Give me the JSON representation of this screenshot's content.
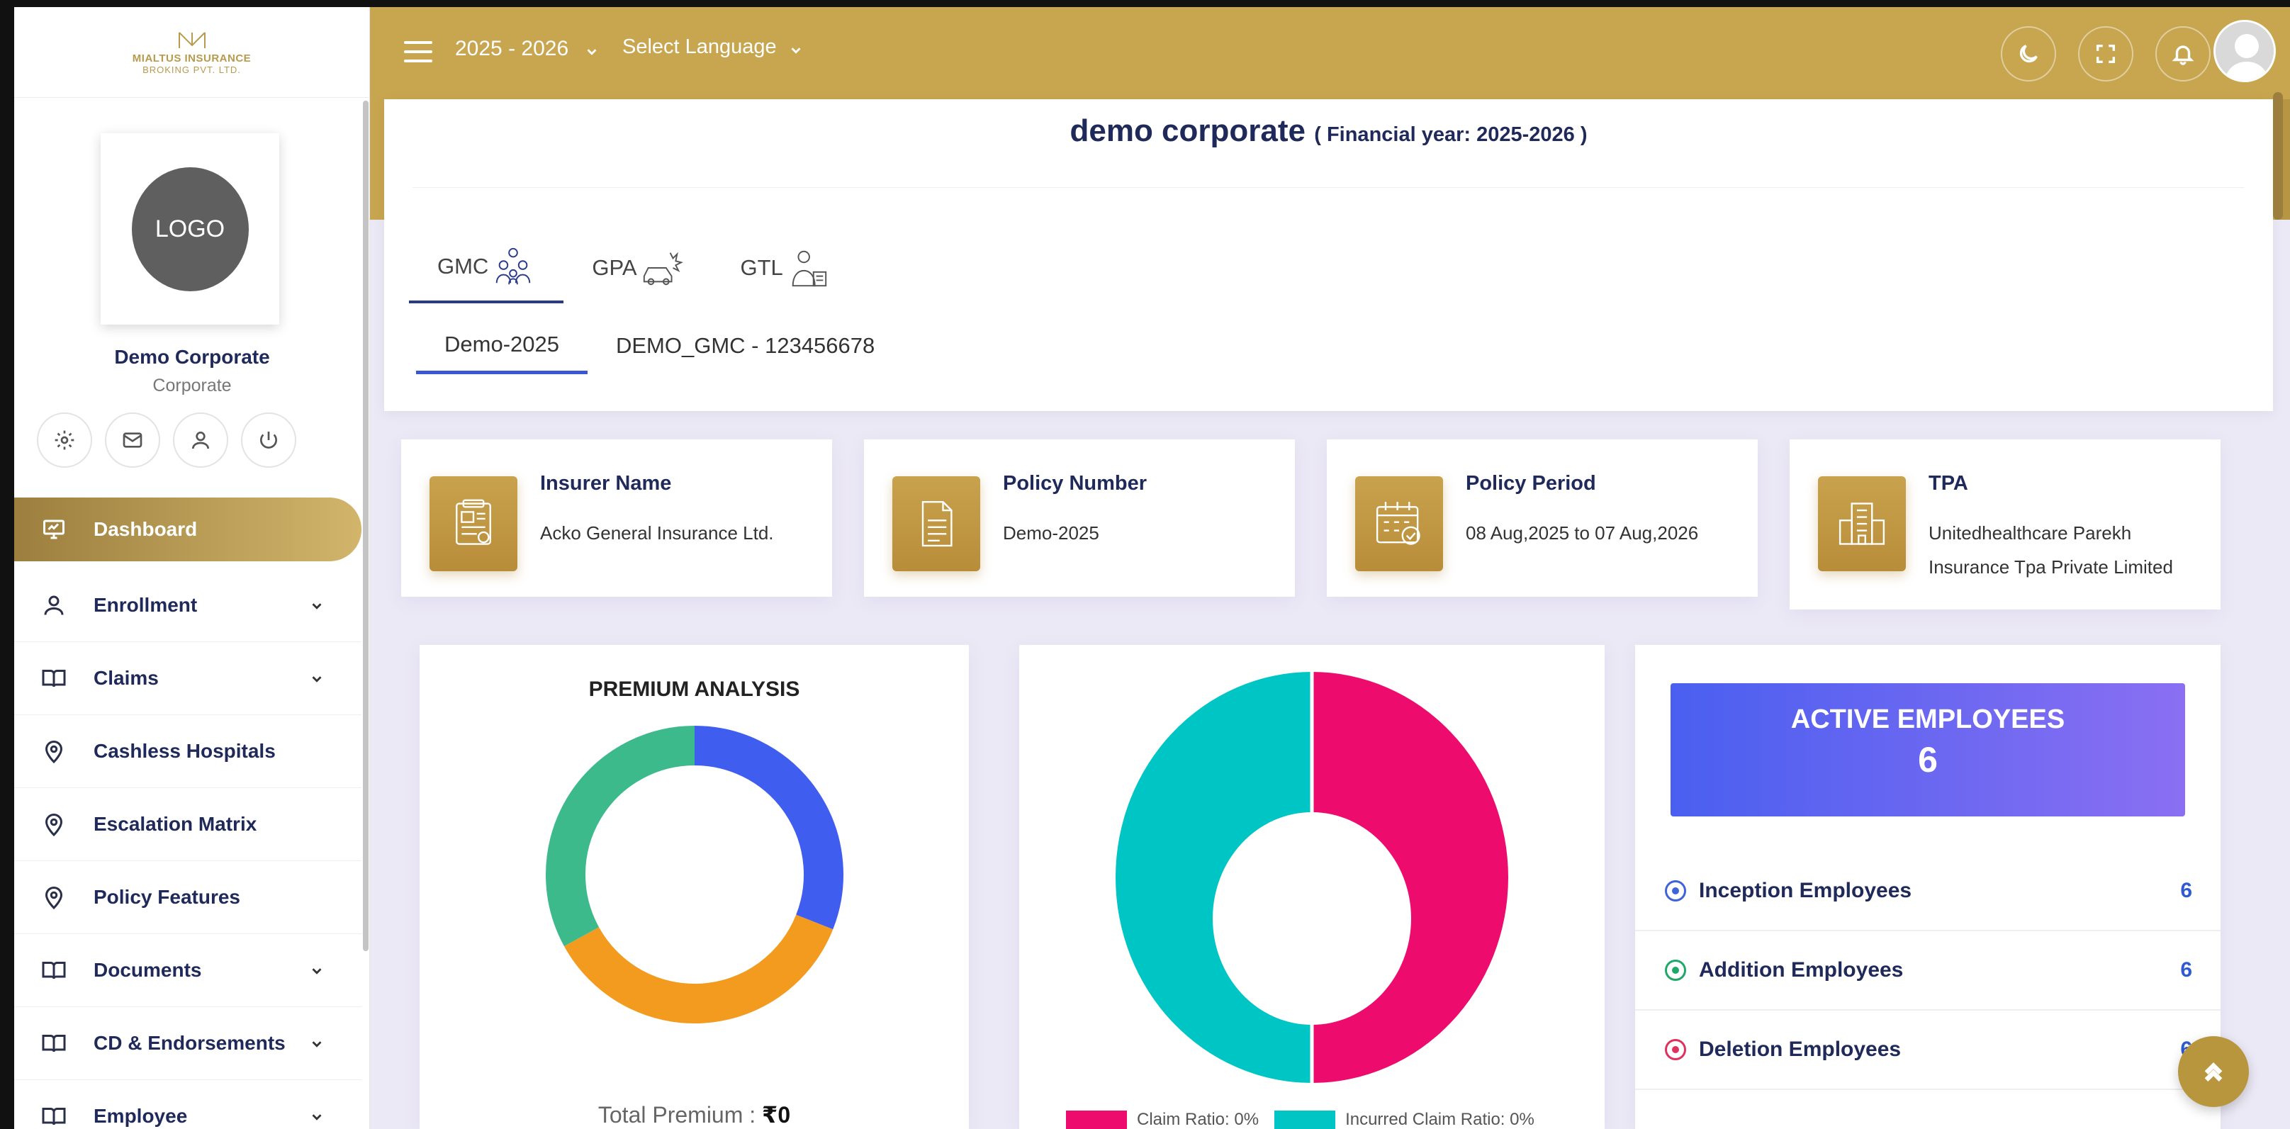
{
  "brand": {
    "name": "MIALTUS INSURANCE",
    "sub": "BROKING PVT. LTD."
  },
  "profile": {
    "logo_text": "LOGO",
    "name": "Demo Corporate",
    "type": "Corporate"
  },
  "menu": [
    {
      "label": "Dashboard",
      "icon": "monitor-icon",
      "expandable": false,
      "active": true
    },
    {
      "label": "Enrollment",
      "icon": "user-icon",
      "expandable": true
    },
    {
      "label": "Claims",
      "icon": "book-icon",
      "expandable": true
    },
    {
      "label": "Cashless Hospitals",
      "icon": "map-pin-icon",
      "expandable": false
    },
    {
      "label": "Escalation Matrix",
      "icon": "map-pin-icon",
      "expandable": false
    },
    {
      "label": "Policy Features",
      "icon": "map-pin-icon",
      "expandable": false
    },
    {
      "label": "Documents",
      "icon": "book-icon",
      "expandable": true
    },
    {
      "label": "CD & Endorsements",
      "icon": "book-icon",
      "expandable": true
    },
    {
      "label": "Employee",
      "icon": "book-icon",
      "expandable": true
    }
  ],
  "header": {
    "financial_year": "2025 - 2026",
    "language": "Select Language"
  },
  "page": {
    "company": "demo corporate",
    "fy_note": "( Financial year: 2025-2026 )"
  },
  "policy_tabs": [
    {
      "label": "GMC",
      "icon": "family-icon",
      "active": true
    },
    {
      "label": "GPA",
      "icon": "car-accident-icon",
      "active": false
    },
    {
      "label": "GTL",
      "icon": "life-insurance-icon",
      "active": false
    }
  ],
  "sub_tabs": [
    {
      "label": "Demo-2025",
      "active": true
    },
    {
      "label": "DEMO_GMC - 123456678",
      "active": false
    }
  ],
  "info_cards": [
    {
      "title": "Insurer Name",
      "value": "Acko General Insurance Ltd.",
      "icon": "id-card-icon"
    },
    {
      "title": "Policy Number",
      "value": "Demo-2025",
      "icon": "document-icon"
    },
    {
      "title": "Policy Period",
      "value": "08 Aug,2025 to 07 Aug,2026",
      "icon": "calendar-icon"
    },
    {
      "title": "TPA",
      "value": "Unitedhealthcare Parekh Insurance Tpa Private Limited",
      "icon": "building-icon"
    }
  ],
  "premium": {
    "title": "PREMIUM ANALYSIS",
    "total_label": "Total Premium :",
    "total_value": "₹0"
  },
  "premium_ring": {
    "segments": [
      {
        "color": "#3f5ef0",
        "fraction": 0.31
      },
      {
        "color": "#f29b1f",
        "fraction": 0.36
      },
      {
        "color": "#3dba8c",
        "fraction": 0.33
      }
    ]
  },
  "claim_chart": {
    "legend": [
      {
        "label": "Claim Ratio: 0%",
        "color": "#ee0b6e"
      },
      {
        "label": "Incurred Claim Ratio: 0%",
        "color": "#00c5c5"
      }
    ]
  },
  "employees": {
    "title": "ACTIVE EMPLOYEES",
    "count": "6",
    "rows": [
      {
        "label": "Inception Employees",
        "count": "6",
        "color": "#3f63d8"
      },
      {
        "label": "Addition Employees",
        "count": "6",
        "color": "#1fa867"
      },
      {
        "label": "Deletion Employees",
        "count": "6",
        "color": "#e0305e"
      }
    ]
  },
  "colors": {
    "accent": "#c8a650",
    "navy": "#1f2a5a"
  }
}
